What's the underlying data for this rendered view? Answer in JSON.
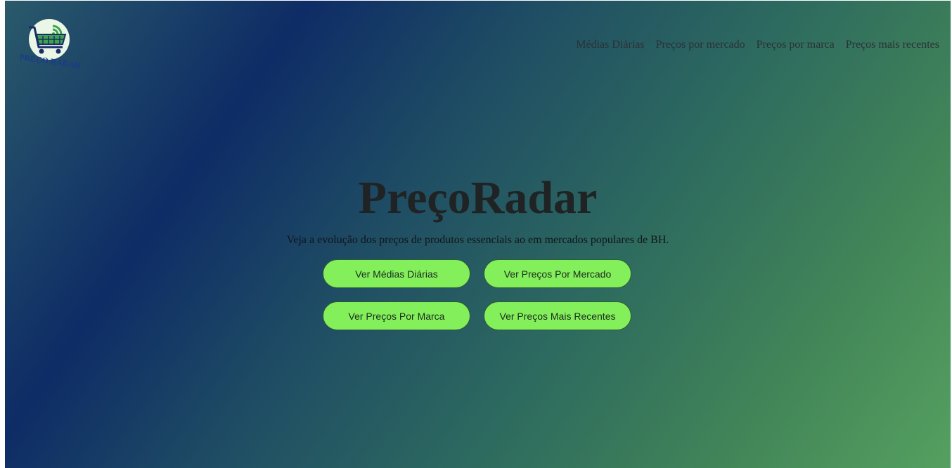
{
  "brand": {
    "logo_text": "PREÇO RADAR",
    "logo_icon": "shopping-cart-radar-icon",
    "colors": {
      "logo_circle": "#eaf6e6",
      "logo_text": "#1a3a8a",
      "cart": "#1b2d6b",
      "radar": "#3fa34d"
    }
  },
  "nav": {
    "items": [
      {
        "label": "Médias Diárias"
      },
      {
        "label": "Preços por mercado"
      },
      {
        "label": "Preços por marca"
      },
      {
        "label": "Preços mais recentes"
      }
    ]
  },
  "hero": {
    "title": "PreçoRadar",
    "subtitle": "Veja a evolução dos preços de produtos essenciais ao em mercados populares de BH."
  },
  "actions": {
    "daily_averages": "Ver Médias Diárias",
    "by_market": "Ver Preços Por Mercado",
    "by_brand": "Ver Preços Por Marca",
    "most_recent": "Ver Preços Mais Recentes"
  },
  "colors": {
    "button_bg": "#83ef5a",
    "gradient_dark": "#0e2c66",
    "gradient_light": "#55a060",
    "title": "#202323"
  }
}
